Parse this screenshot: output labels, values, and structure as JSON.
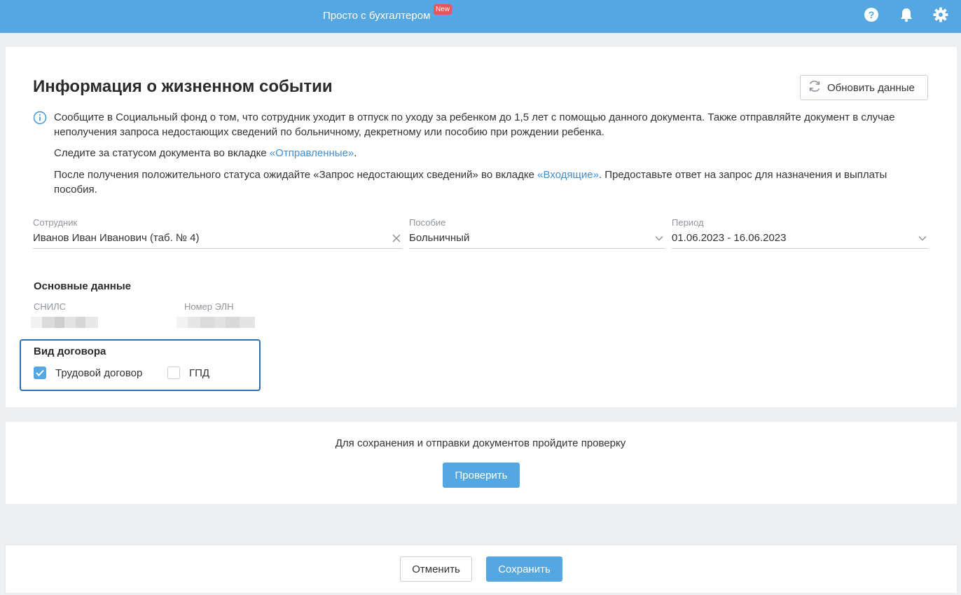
{
  "header": {
    "brand": "Просто с бухгалтером",
    "badge": "New"
  },
  "icons": [
    "help-icon",
    "bell-icon",
    "gear-icon",
    "refresh-icon",
    "info-icon",
    "clear-icon",
    "chevron-down-icon",
    "check-icon"
  ],
  "colors": {
    "accent": "#54a7e0",
    "link": "#3f8fd2",
    "badge": "#e8555a",
    "highlight_border": "#2e6bb6"
  },
  "main": {
    "title": "Информация о жизненном событии",
    "refresh_button": "Обновить данные",
    "info": {
      "p1_line1": "Сообщите в Социальный фонд о том, что сотрудник уходит в отпуск по уходу за ребенком до 1,5 лет с помощью данного документа. Также отправляйте документ в случае",
      "p1_line2": "неполучения запроса недостающих сведений по больничному, декретному или пособию при рождении ребенка.",
      "p2_before": "Следите за статусом документа во вкладке ",
      "p2_link": "«Отправленные»",
      "p2_after": ".",
      "p3_before": "После получения положительного статуса ожидайте «Запрос недостающих сведений» во вкладке ",
      "p3_link": "«Входящие»",
      "p3_after": ". Предоставьте ответ на запрос для назначения и выплаты",
      "p3_line2": "пособия."
    },
    "fields": {
      "employee": {
        "label": "Сотрудник",
        "value": "Иванов Иван Иванович (таб. № 4)"
      },
      "benefit": {
        "label": "Пособие",
        "value": "Больничный"
      },
      "period": {
        "label": "Период",
        "value": "01.06.2023 - 16.06.2023"
      }
    },
    "basic": {
      "title": "Основные данные",
      "snils_label": "СНИЛС",
      "eln_label": "Номер ЭЛН"
    },
    "contract": {
      "title": "Вид договора",
      "options": [
        {
          "label": "Трудовой договор",
          "checked": true
        },
        {
          "label": "ГПД",
          "checked": false
        }
      ]
    }
  },
  "check": {
    "text": "Для сохранения и отправки документов пройдите проверку",
    "button": "Проверить"
  },
  "footer": {
    "cancel": "Отменить",
    "save": "Сохранить"
  }
}
